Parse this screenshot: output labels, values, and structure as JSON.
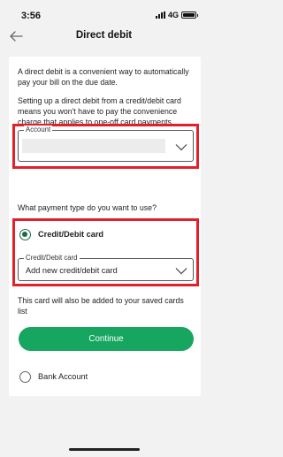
{
  "status": {
    "time": "3:56",
    "network": "4G"
  },
  "header": {
    "title": "Direct debit"
  },
  "intro": {
    "p1": "A direct debit is a convenient way to automatically pay your bill on the due date.",
    "p2": "Setting up a direct debit from a credit/debit card means you won't have to pay the convenience charge that applies to one-off card payments."
  },
  "account": {
    "label": "Account",
    "value": ""
  },
  "payment": {
    "question": "What payment type do you want to use?",
    "option_card": "Credit/Debit card",
    "option_bank": "Bank Account",
    "card_field_label": "Credit/Debit card",
    "card_field_value": "Add new credit/debit card",
    "note": "This card will also be added to your saved cards list"
  },
  "actions": {
    "continue_label": "Continue"
  },
  "colors": {
    "accent": "#16a660",
    "highlight": "#e2202a",
    "radio": "#1e6a45"
  }
}
